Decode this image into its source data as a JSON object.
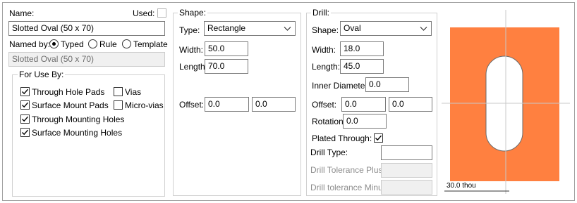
{
  "general": {
    "name_label": "Name:",
    "used_label": "Used:",
    "name_value": "Slotted Oval (50 x 70)",
    "named_by_label": "Named by:",
    "radio_typed": "Typed",
    "radio_rule": "Rule",
    "radio_template": "Template",
    "rule_name_value": "Slotted Oval (50 x 70)",
    "for_use_by_title": "For Use By:",
    "checks": {
      "through_hole_pads": "Through Hole Pads",
      "surface_mount_pads": "Surface Mount Pads",
      "through_mounting_holes": "Through Mounting Holes",
      "surface_mounting_holes": "Surface Mounting Holes",
      "vias": "Vias",
      "micro_vias": "Micro-vias"
    }
  },
  "shape": {
    "title": "Shape:",
    "type_label": "Type:",
    "type_value": "Rectangle",
    "width_label": "Width:",
    "width_value": "50.0",
    "length_label": "Length:",
    "length_value": "70.0",
    "offset_label": "Offset:",
    "offset_x": "0.0",
    "offset_y": "0.0"
  },
  "drill": {
    "title": "Drill:",
    "shape_label": "Shape:",
    "shape_value": "Oval",
    "width_label": "Width:",
    "width_value": "18.0",
    "length_label": "Length:",
    "length_value": "45.0",
    "inner_diameter_label": "Inner Diameter:",
    "inner_diameter_value": "0.0",
    "offset_label": "Offset:",
    "offset_x": "0.0",
    "offset_y": "0.0",
    "rotation_label": "Rotation:",
    "rotation_value": "0.0",
    "plated_through_label": "Plated Through:",
    "drill_type_label": "Drill Type:",
    "drill_type_value": "",
    "tolerance_plus_label": "Drill Tolerance Plus:",
    "tolerance_minus_label": "Drill tolerance Minus:"
  },
  "preview": {
    "scale_label": "30.0 thou",
    "pad_color": "#ff8040",
    "hole_color": "#ffffff"
  }
}
